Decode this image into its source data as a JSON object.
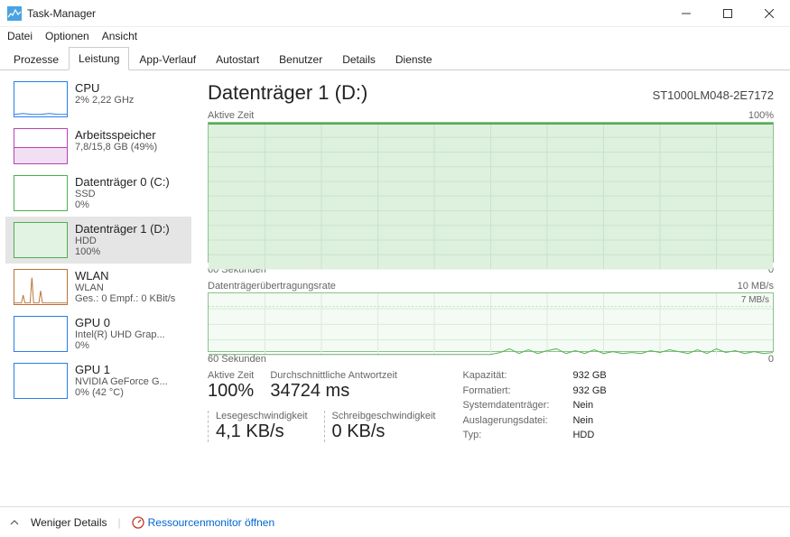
{
  "window": {
    "title": "Task-Manager"
  },
  "menu": {
    "file": "Datei",
    "options": "Optionen",
    "view": "Ansicht"
  },
  "tabs": {
    "processes": "Prozesse",
    "performance": "Leistung",
    "apphistory": "App-Verlauf",
    "startup": "Autostart",
    "users": "Benutzer",
    "details": "Details",
    "services": "Dienste"
  },
  "sidebar": [
    {
      "title": "CPU",
      "sub1": "2% 2,22 GHz",
      "sub2": "",
      "color": "#2b7de9"
    },
    {
      "title": "Arbeitsspeicher",
      "sub1": "7,8/15,8 GB (49%)",
      "sub2": "",
      "color": "#b444b4"
    },
    {
      "title": "Datenträger 0 (C:)",
      "sub1": "SSD",
      "sub2": "0%",
      "color": "#4caf50"
    },
    {
      "title": "Datenträger 1 (D:)",
      "sub1": "HDD",
      "sub2": "100%",
      "color": "#4caf50"
    },
    {
      "title": "WLAN",
      "sub1": "WLAN",
      "sub2": "Ges.: 0 Empf.: 0 KBit/s",
      "color": "#b87333"
    },
    {
      "title": "GPU 0",
      "sub1": "Intel(R) UHD Grap...",
      "sub2": "0%",
      "color": "#2b7de9"
    },
    {
      "title": "GPU 1",
      "sub1": "NVIDIA GeForce G...",
      "sub2": "0% (42 °C)",
      "color": "#2b7de9"
    }
  ],
  "main": {
    "title": "Datenträger 1 (D:)",
    "model": "ST1000LM048-2E7172",
    "graph1": {
      "label": "Aktive Zeit",
      "max": "100%",
      "xleft": "60 Sekunden",
      "xright": "0"
    },
    "graph2": {
      "label": "Datenträgerübertragungsrate",
      "max": "10 MB/s",
      "inner": "7 MB/s",
      "xleft": "60 Sekunden",
      "xright": "0"
    },
    "stats": {
      "active_label": "Aktive Zeit",
      "active_value": "100%",
      "resp_label": "Durchschnittliche Antwortzeit",
      "resp_value": "34724 ms",
      "read_label": "Lesegeschwindigkeit",
      "read_value": "4,1 KB/s",
      "write_label": "Schreibgeschwindigkeit",
      "write_value": "0 KB/s",
      "capacity_k": "Kapazität:",
      "capacity_v": "932 GB",
      "formatted_k": "Formatiert:",
      "formatted_v": "932 GB",
      "sysdisk_k": "Systemdatenträger:",
      "sysdisk_v": "Nein",
      "pagefile_k": "Auslagerungsdatei:",
      "pagefile_v": "Nein",
      "type_k": "Typ:",
      "type_v": "HDD"
    }
  },
  "footer": {
    "fewer": "Weniger Details",
    "resmon": "Ressourcenmonitor öffnen"
  },
  "chart_data": [
    {
      "type": "area",
      "title": "Aktive Zeit",
      "ylabel": "%",
      "ylim": [
        0,
        100
      ],
      "x_seconds": [
        60,
        0
      ],
      "values": [
        100,
        100,
        100,
        100,
        100,
        100,
        100,
        100,
        100,
        100,
        100,
        100,
        100,
        100,
        100,
        100,
        100,
        100,
        100,
        100,
        100,
        100,
        100,
        100,
        100,
        100,
        100,
        100,
        100,
        100,
        100,
        100,
        100,
        100,
        100,
        100,
        100,
        100,
        100,
        100,
        100,
        100,
        100,
        100,
        100,
        100,
        100,
        100,
        100,
        100,
        100,
        100,
        100,
        100,
        100,
        100,
        100,
        100,
        100,
        100
      ]
    },
    {
      "type": "line",
      "title": "Datenträgerübertragungsrate",
      "ylabel": "MB/s",
      "ylim": [
        0,
        10
      ],
      "marker_line": 7,
      "x_seconds": [
        60,
        0
      ],
      "values": [
        0,
        0,
        0,
        0,
        0,
        0,
        0,
        0,
        0,
        0,
        0,
        0,
        0,
        0,
        0,
        0,
        0,
        0,
        0,
        0,
        0,
        0,
        0,
        0,
        0,
        0,
        0,
        0,
        0,
        0,
        0.4,
        0.9,
        0.3,
        0.8,
        0.2,
        0.7,
        0.4,
        0.9,
        0.3,
        0.6,
        0.2,
        0.8,
        0.3,
        0.5,
        0.2,
        0.3,
        0.2,
        0.6,
        0.4,
        0.7,
        0.5,
        0.3,
        0.7,
        0.2,
        0.8,
        0.4,
        0.6,
        0.3,
        0.5,
        0.3
      ]
    }
  ]
}
